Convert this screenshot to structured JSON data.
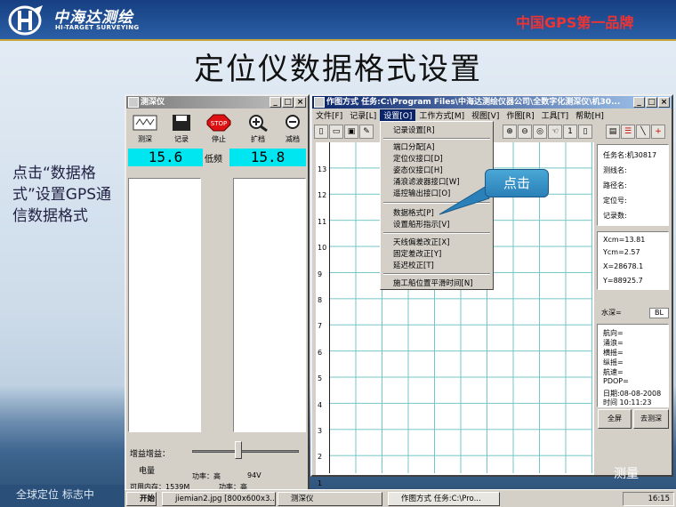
{
  "slide": {
    "brand_cn": "中海达测绘",
    "brand_en": "HI-TARGET SURVEYING",
    "slogan": "中国GPS第一品牌",
    "title": "定位仪数据格式设置",
    "side_text": "点击“数据格式”设置GPS通信数据格式",
    "callout": "点击",
    "bottom_strip": "全球定位  标志中",
    "watermark": "测量"
  },
  "sounder": {
    "title": "测深仪",
    "tools": [
      "测深",
      "记录",
      "停止",
      "扩档",
      "减档"
    ],
    "stop_sign": "STOP",
    "depth_left": "15.6",
    "depth_right": "15.8",
    "freq_label": "低频",
    "gain_label": "增益增益：",
    "power_label": "电量",
    "power_val": "功率：高",
    "voltage": "94V",
    "mem_label": "可用内存：1539M",
    "power2": "功率：高"
  },
  "plot": {
    "title": "作图方式  任务:C:\\Program Files\\中海达测绘仪器公司\\全数字化测深仪\\机30...",
    "menu": [
      "文件[F]",
      "记录[L]",
      "设置[O]",
      "工作方式[M]",
      "视图[V]",
      "作图[R]",
      "工具[T]",
      "帮助[H]"
    ],
    "y_ticks": [
      "13",
      "12",
      "11",
      "10",
      "9",
      "8",
      "7",
      "6",
      "5",
      "4",
      "3",
      "2",
      "1"
    ]
  },
  "dropdown": {
    "items": [
      "记录设置[R]",
      "端口分配[A]",
      "定位仪接口[D]",
      "姿态仪接口[H]",
      "涌浪滤波器接口[W]",
      "遥控输出接口[O]",
      "数据格式[P]",
      "设置船形指示[V]",
      "天线偏差改正[X]",
      "固定差改正[Y]",
      "延迟校正[T]",
      "施工船位置平滑时间[N]"
    ]
  },
  "info": {
    "task": "任务名:机30817",
    "line": "测线名:",
    "route": "路径名:",
    "fix": "定位号:",
    "records": "记录数:",
    "xcm": "Xcm=13.81",
    "ycm": "Ycm=2.57",
    "x": "X=28678.1",
    "y": "Y=88925.7",
    "depth": "水深=",
    "bl": "BL",
    "heading": "航向=",
    "swell": "涌浪=",
    "roll": "横摇=",
    "pitch": "纵摇=",
    "speed": "航速=",
    "pdop": "PDOP=",
    "date": "日期:08-08-2008",
    "time": "时间 10:11:23",
    "btn_full": "全屏",
    "btn_noise": "去测深"
  },
  "taskbar": {
    "start": "开始",
    "t1": "jiemian2.jpg [800x600x3...",
    "t2": "测深仪",
    "t3": "作图方式  任务:C:\\Pro...",
    "clock": "16:15"
  },
  "colors": {
    "title_active": "#0a246a",
    "digit_bg": "#00e6f0",
    "grid": "#2aa9a9",
    "callout": "#2a80b8",
    "slogan": "#e33333"
  }
}
